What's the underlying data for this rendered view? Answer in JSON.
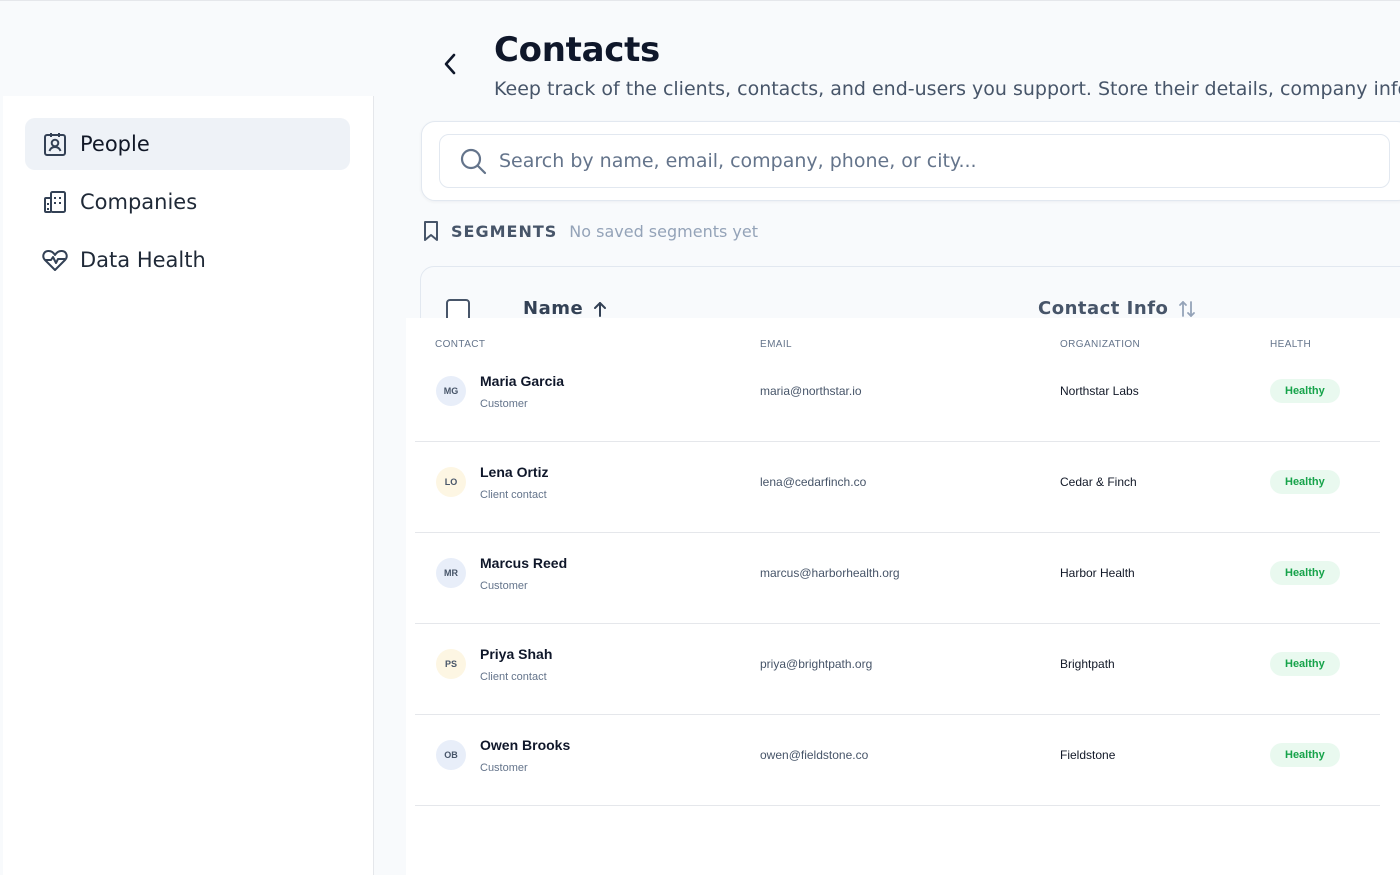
{
  "sidebar": {
    "items": [
      {
        "label": "People",
        "icon": "contact-card-icon",
        "active": true
      },
      {
        "label": "Companies",
        "icon": "building-icon",
        "active": false
      },
      {
        "label": "Data Health",
        "icon": "heart-pulse-icon",
        "active": false
      }
    ]
  },
  "header": {
    "title": "Contacts",
    "subtitle": "Keep track of the clients, contacts, and end-users you support. Store their details, company info, and w"
  },
  "search": {
    "placeholder": "Search by name, email, company, phone, or city...",
    "value": ""
  },
  "segments": {
    "label": "SEGMENTS",
    "empty_text": "No saved segments yet"
  },
  "main_table": {
    "columns": {
      "name": "Name",
      "contact_info": "Contact Info"
    }
  },
  "contacts_table": {
    "headers": {
      "contact": "CONTACT",
      "email": "EMAIL",
      "organization": "ORGANIZATION",
      "health": "HEALTH"
    },
    "rows": [
      {
        "initials": "MG",
        "name": "Maria Garcia",
        "role": "Customer",
        "email": "maria@northstar.io",
        "organization": "Northstar Labs",
        "health": "Healthy",
        "avatar_color": "blue"
      },
      {
        "initials": "LO",
        "name": "Lena Ortiz",
        "role": "Client contact",
        "email": "lena@cedarfinch.co",
        "organization": "Cedar & Finch",
        "health": "Healthy",
        "avatar_color": "yellow"
      },
      {
        "initials": "MR",
        "name": "Marcus Reed",
        "role": "Customer",
        "email": "marcus@harborhealth.org",
        "organization": "Harbor Health",
        "health": "Healthy",
        "avatar_color": "blue"
      },
      {
        "initials": "PS",
        "name": "Priya Shah",
        "role": "Client contact",
        "email": "priya@brightpath.org",
        "organization": "Brightpath",
        "health": "Healthy",
        "avatar_color": "yellow"
      },
      {
        "initials": "OB",
        "name": "Owen Brooks",
        "role": "Customer",
        "email": "owen@fieldstone.co",
        "organization": "Fieldstone",
        "health": "Healthy",
        "avatar_color": "blue"
      }
    ]
  },
  "colors": {
    "healthy_text": "#16a34a",
    "healthy_bg": "#e9f9ef",
    "active_nav_bg": "#eef2f7"
  }
}
